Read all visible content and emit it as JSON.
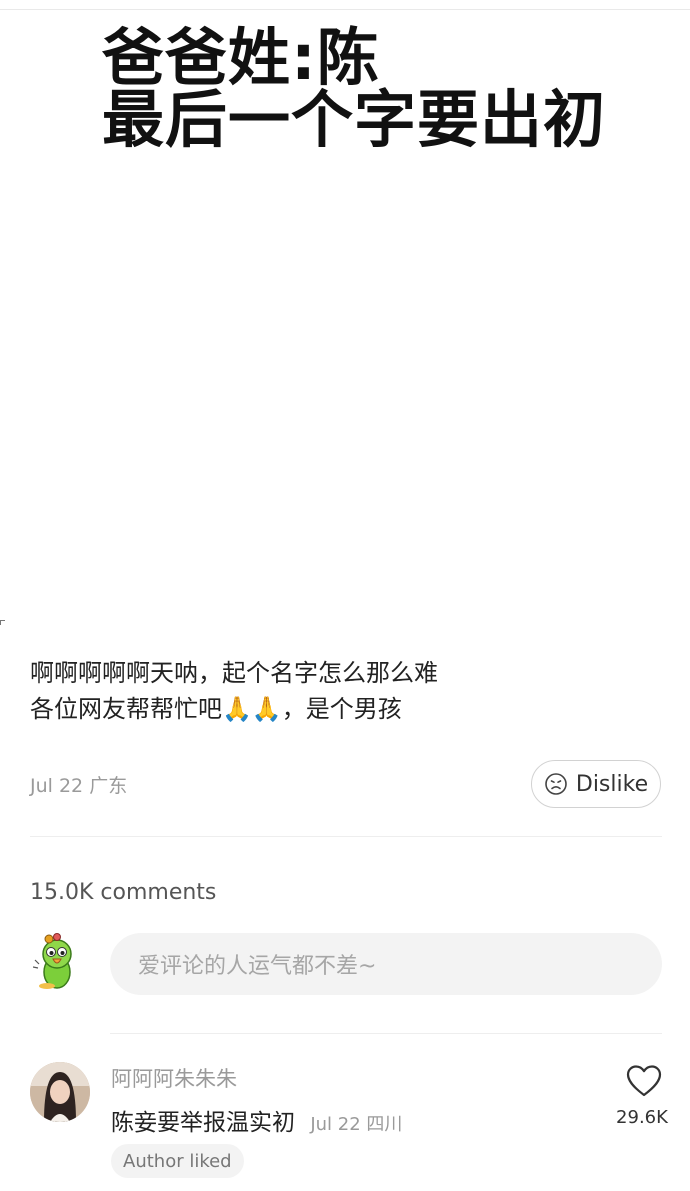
{
  "hero": {
    "line1": "爸爸姓:陈",
    "line2": "最后一个字要出初"
  },
  "post": {
    "line1": "啊啊啊啊啊天呐，起个名字怎么那么难",
    "line2": "各位网友帮帮忙吧🙏🙏，是个男孩",
    "date": "Jul 22",
    "location": "广东",
    "dislike_label": "Dislike"
  },
  "comments": {
    "count_label": "15.0K comments",
    "input_placeholder": "爱评论的人运气都不差~",
    "items": [
      {
        "username": "阿阿阿朱朱朱",
        "text": "陈妾要举报温实初",
        "date": "Jul 22",
        "location": "四川",
        "badge": "Author liked",
        "likes": "29.6K"
      }
    ]
  },
  "icons": {
    "dislike": "frown-face-icon",
    "like": "heart-outline-icon",
    "self_avatar": "parrot-sticker-avatar"
  },
  "colors": {
    "muted_text": "#9a9a9a",
    "input_bg": "#f3f3f3",
    "divider": "#eeeeee"
  }
}
